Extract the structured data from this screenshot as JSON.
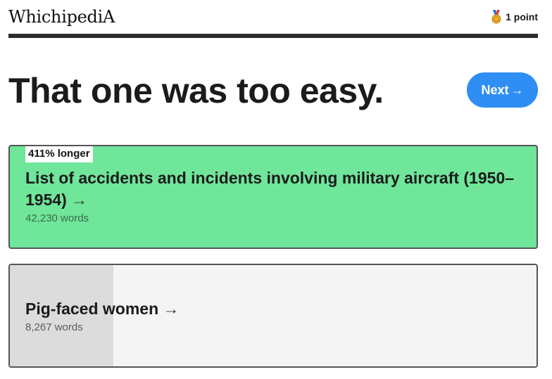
{
  "header": {
    "logo": "WhichipediA",
    "points": "1 point",
    "points_icon": "medal-icon"
  },
  "main": {
    "result_title": "That one was too easy.",
    "next_button": {
      "label": "Next",
      "arrow": "→"
    }
  },
  "cards": [
    {
      "badge": "411% longer",
      "title": "List of accidents and incidents involving military aircraft (1950–1954)",
      "arrow": "→",
      "word_count": "42,230 words",
      "background": "#6fe69a"
    },
    {
      "title": "Pig-faced women",
      "arrow": "→",
      "word_count": "8,267 words",
      "background": "#f4f4f4",
      "relative_length": 0.196
    }
  ],
  "colors": {
    "accent": "#2e8ef4",
    "winner": "#6fe69a",
    "divider": "#2b2b2b"
  }
}
